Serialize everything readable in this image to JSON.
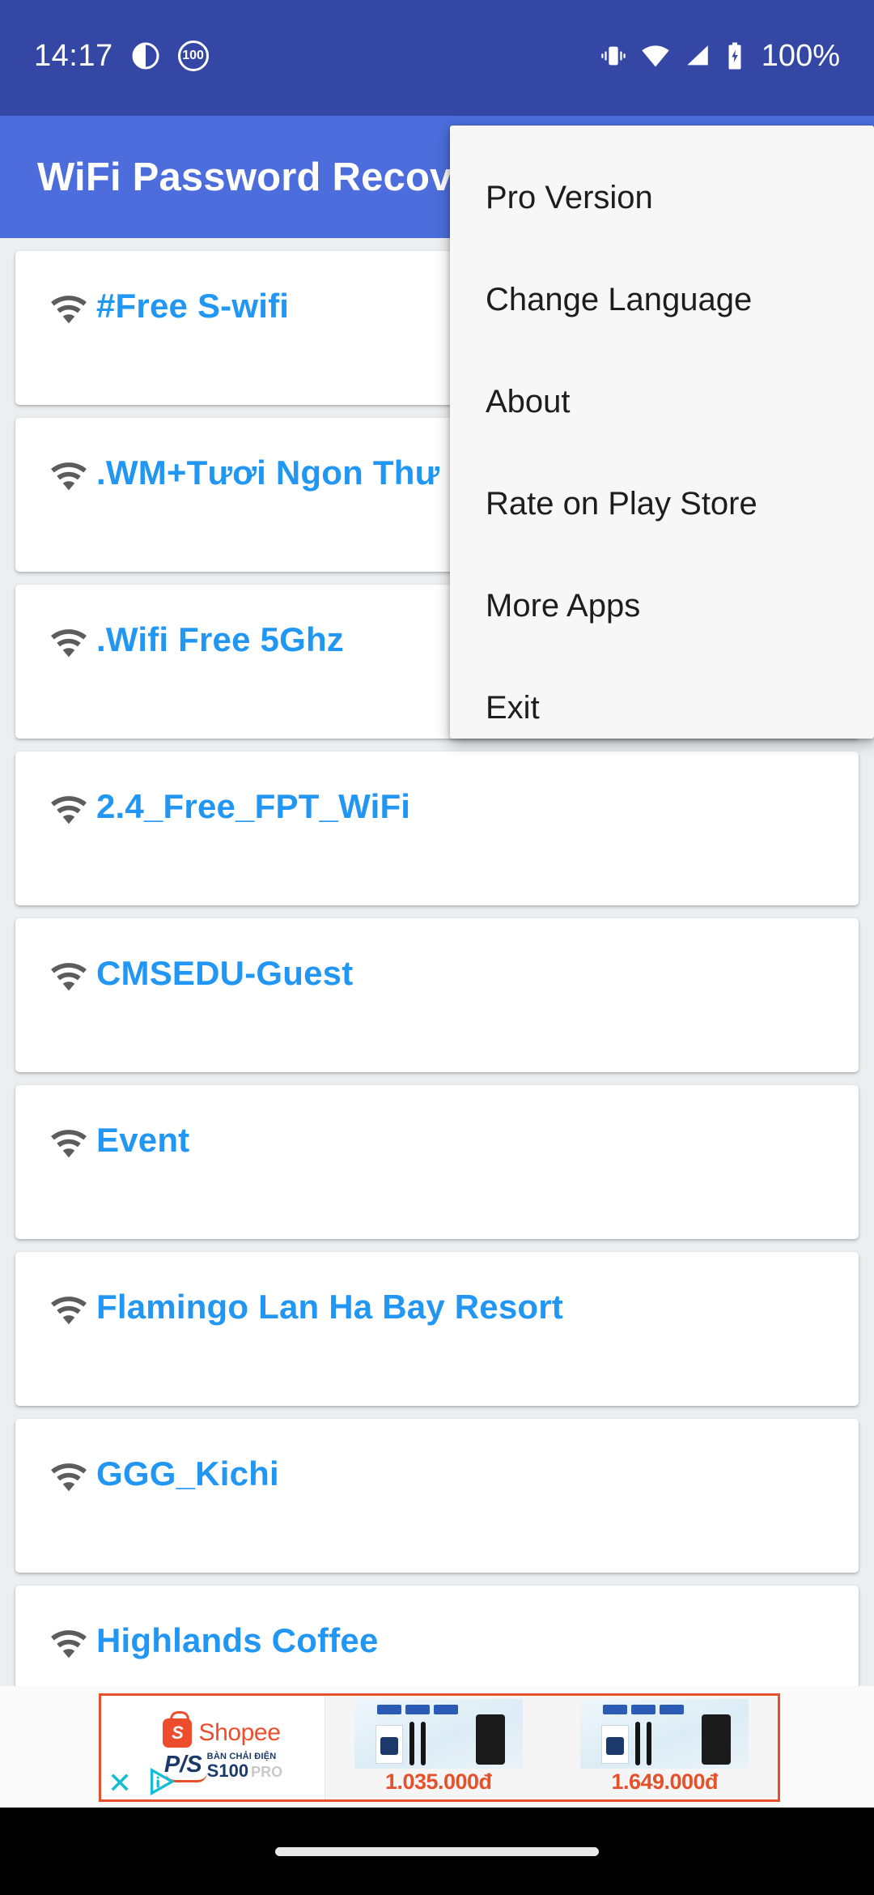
{
  "status_bar": {
    "time": "14:17",
    "battery_percent": "100%",
    "battery_badge": "100",
    "icons": [
      "do-not-disturb-icon",
      "battery-saver-100-icon",
      "vibrate-icon",
      "wifi-icon",
      "cellular-signal-icon",
      "battery-charging-icon"
    ]
  },
  "app_bar": {
    "title": "WiFi Password Recovery"
  },
  "menu": {
    "items": [
      {
        "label": "Pro Version"
      },
      {
        "label": "Change Language"
      },
      {
        "label": "About"
      },
      {
        "label": "Rate on Play Store"
      },
      {
        "label": "More Apps"
      },
      {
        "label": "Exit"
      }
    ]
  },
  "wifi_list": {
    "icon": "wifi-signal-icon",
    "networks": [
      {
        "ssid": "#Free S-wifi"
      },
      {
        "ssid": ".WM+Tươi Ngon Thư"
      },
      {
        "ssid": ".Wifi Free 5Ghz"
      },
      {
        "ssid": "2.4_Free_FPT_WiFi"
      },
      {
        "ssid": "CMSEDU-Guest"
      },
      {
        "ssid": "Event"
      },
      {
        "ssid": "Flamingo  Lan Ha Bay Resort"
      },
      {
        "ssid": "GGG_Kichi"
      },
      {
        "ssid": "Highlands Coffee"
      }
    ]
  },
  "ad": {
    "close_label": "✕",
    "brand": "Shopee",
    "brand_mark": "S",
    "product_line1": "BÀN CHẢI ĐIỆN",
    "product_line2": "S100",
    "product_line2_suffix": "PRO",
    "products": [
      {
        "price": "1.035.000đ"
      },
      {
        "price": "1.649.000đ"
      }
    ]
  },
  "colors": {
    "status_bar": "#3447a5",
    "app_bar": "#4c6ddb",
    "ssid_text": "#2196f3",
    "page_bg": "#eceff1",
    "menu_bg": "#f7f7f7",
    "ad_border": "#e5512a",
    "shopee_orange": "#ee4d2d"
  }
}
